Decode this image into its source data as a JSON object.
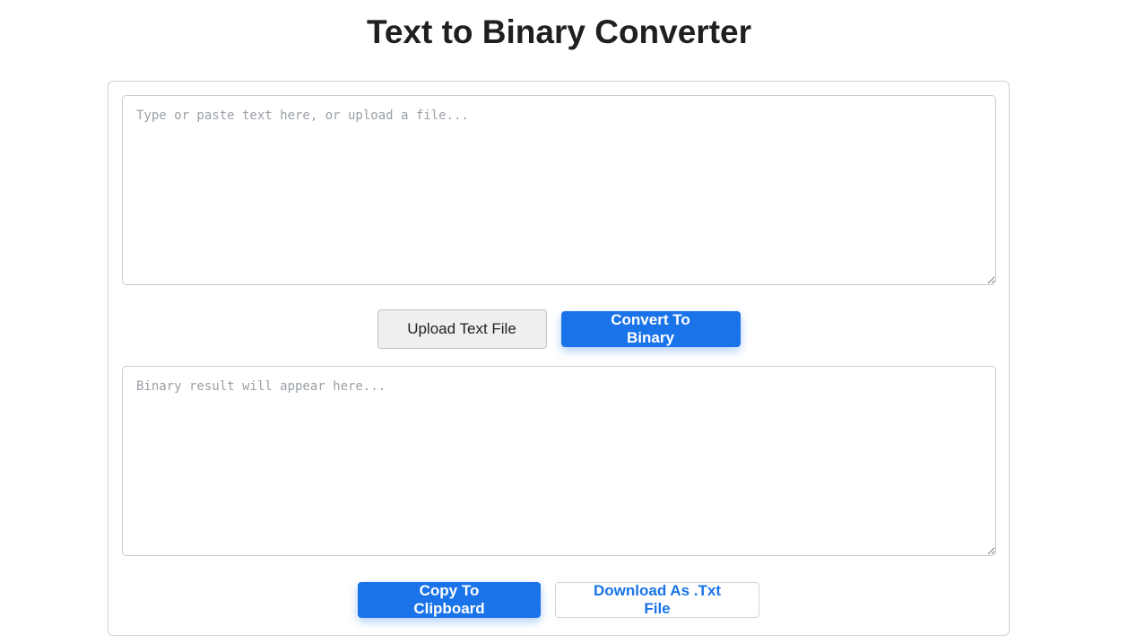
{
  "header": {
    "title": "Text to Binary Converter"
  },
  "input": {
    "placeholder": "Type or paste text here, or upload a file...",
    "value": ""
  },
  "actions": {
    "upload_label": "Upload Text File",
    "convert_label": "Convert To Binary"
  },
  "output": {
    "placeholder": "Binary result will appear here...",
    "value": ""
  },
  "output_actions": {
    "copy_label": "Copy To Clipboard",
    "download_label": "Download As .Txt File"
  },
  "colors": {
    "accent": "#1a73e8",
    "secondary_button_bg": "#efefef",
    "border": "#cfd3d8"
  }
}
